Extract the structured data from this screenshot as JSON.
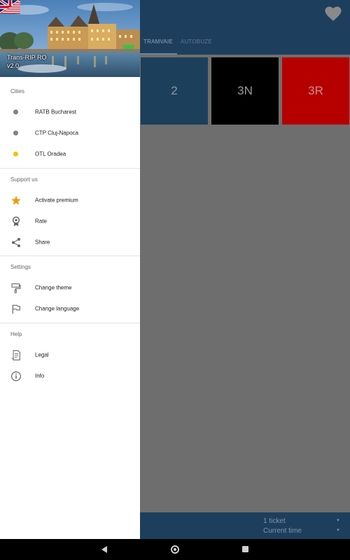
{
  "main": {
    "tabs": [
      {
        "label": "TRAMVAIE",
        "active": true
      },
      {
        "label": "AUTOBUZE",
        "active": false
      }
    ],
    "tiles": [
      {
        "label": "2",
        "color": "#1c3f5c"
      },
      {
        "label": "3N",
        "color": "#000000"
      },
      {
        "label": "3R",
        "color": "#b60000"
      }
    ],
    "bottom": {
      "ticket": "1 ticket",
      "time": "Current time"
    }
  },
  "drawer": {
    "header": {
      "app_name": "Trans-RIP RO",
      "version": "v2.0"
    },
    "sections": {
      "cities": {
        "title": "Cities",
        "items": [
          {
            "label": "RATB Bucharest",
            "dot_color": "#78838c"
          },
          {
            "label": "CTP Cluj-Napoca",
            "dot_color": "#78838c"
          },
          {
            "label": "OTL Oradea",
            "dot_color": "#f2c300"
          }
        ]
      },
      "support": {
        "title": "Support us",
        "items": [
          {
            "label": "Activate premium",
            "icon": "star-icon",
            "icon_color": "#f39c12"
          },
          {
            "label": "Rate",
            "icon": "award-icon"
          },
          {
            "label": "Share",
            "icon": "share-icon"
          }
        ]
      },
      "settings": {
        "title": "Settings",
        "items": [
          {
            "label": "Change theme",
            "icon": "theme-icon"
          },
          {
            "label": "Change language",
            "icon": "flag-icon"
          }
        ]
      },
      "help": {
        "title": "Help",
        "items": [
          {
            "label": "Legal",
            "icon": "legal-document-icon"
          },
          {
            "label": "Info",
            "icon": "info-icon"
          }
        ]
      }
    }
  }
}
